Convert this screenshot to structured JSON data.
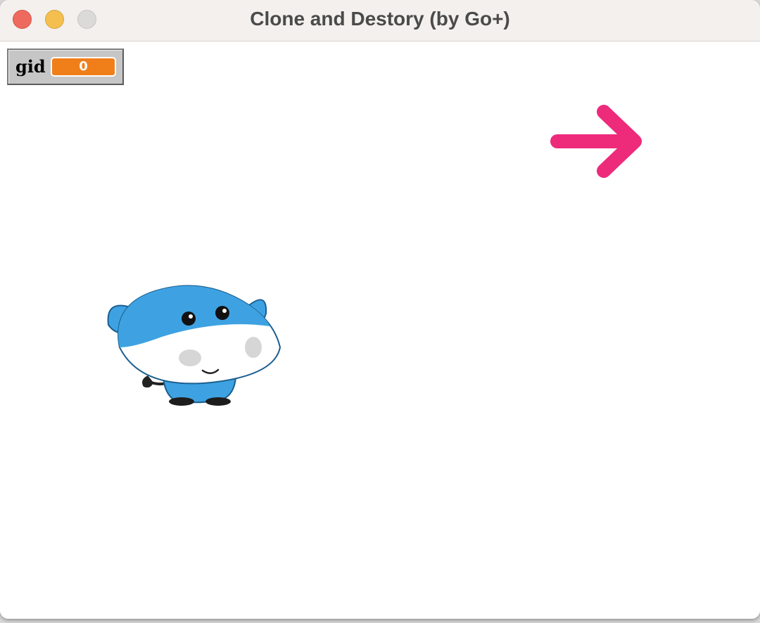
{
  "window": {
    "title": "Clone and Destory (by Go+)"
  },
  "monitor": {
    "label": "gid",
    "value": "0"
  },
  "sprites": {
    "arrow": {
      "icon": "arrow-right-icon",
      "color": "#ee2a7b"
    },
    "mascot": {
      "icon": "cow-mascot",
      "color": "#3ea2e2"
    }
  },
  "colors": {
    "close": "#ee6a5e",
    "minimize": "#f5bf4f",
    "maximize": "#dcdad8",
    "monitor_value": "#f07f1a"
  }
}
